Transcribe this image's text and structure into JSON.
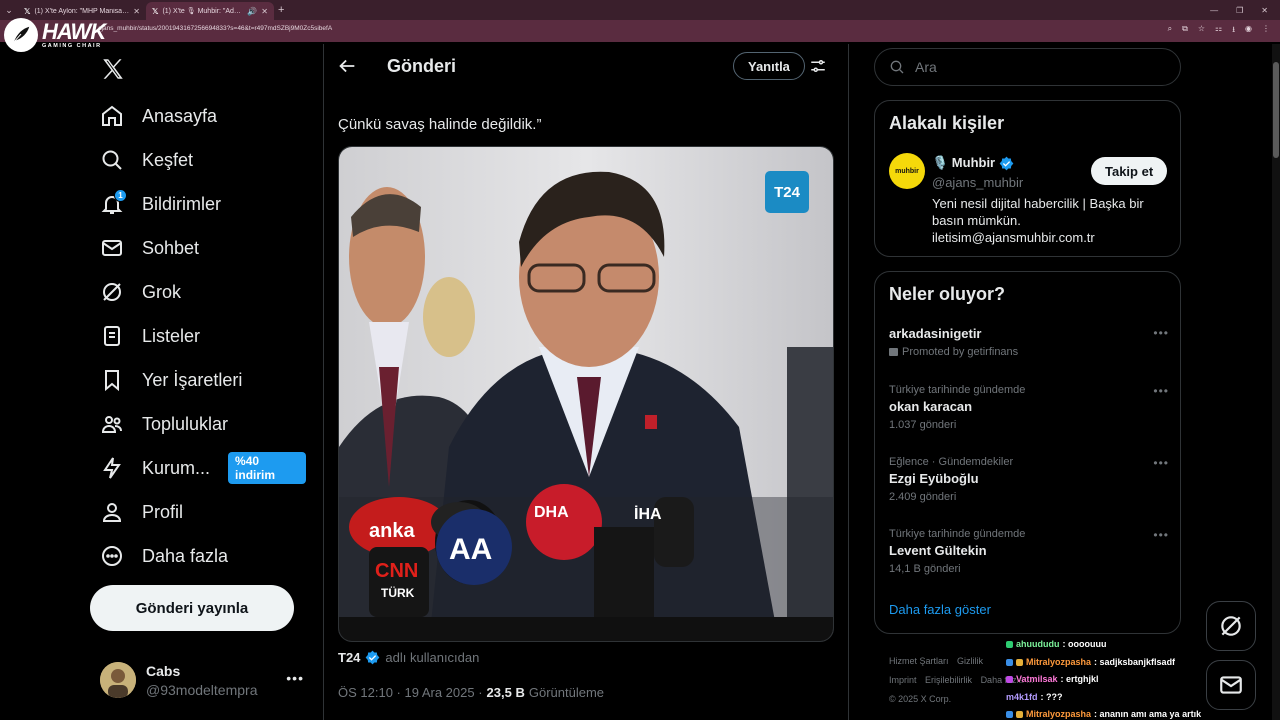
{
  "browser": {
    "tabs": [
      {
        "label": "(1) X'te Aylon: \"MHP Manisa M",
        "active": false
      },
      {
        "label": "(1) X'te 🎙 Muhbir: \"Adalet",
        "active": true
      }
    ],
    "url": "ajans_muhbir/status/2001943167256694833?s=46&t=r497mdSZBj9M0Zc5sibefA"
  },
  "overlay_logo": {
    "big": "HAWK",
    "small": "GAMING CHAIR"
  },
  "nav": {
    "items": [
      {
        "label": "Anasayfa",
        "icon": "home-icon"
      },
      {
        "label": "Keşfet",
        "icon": "search-icon"
      },
      {
        "label": "Bildirimler",
        "icon": "bell-icon",
        "badge": "1"
      },
      {
        "label": "Sohbet",
        "icon": "mail-icon"
      },
      {
        "label": "Grok",
        "icon": "grok-icon"
      },
      {
        "label": "Listeler",
        "icon": "list-icon"
      },
      {
        "label": "Yer İşaretleri",
        "icon": "bookmark-icon"
      },
      {
        "label": "Topluluklar",
        "icon": "people-icon"
      },
      {
        "label": "Kurum...",
        "icon": "bolt-icon",
        "promo": "%40 indirim"
      },
      {
        "label": "Profil",
        "icon": "person-icon"
      },
      {
        "label": "Daha fazla",
        "icon": "more-circle-icon"
      }
    ],
    "post_button": "Gönderi yayınla",
    "account": {
      "name": "Cabs",
      "handle": "@93modeltempra"
    }
  },
  "main": {
    "title": "Gönderi",
    "reply_button": "Yanıtla",
    "tweet_text": "Çünkü savaş halinde değildik.”",
    "media_badge": "T24",
    "source_name": "T24",
    "source_via": "adlı kullanıcıdan",
    "time": "ÖS 12:10 · 19 Ara 2025 ·",
    "views": "23,5 B",
    "views_label": "Görüntüleme"
  },
  "right": {
    "search_placeholder": "Ara",
    "related": {
      "title": "Alakalı kişiler",
      "name": "🎙️ Muhbir",
      "handle": "@ajans_muhbir",
      "avatar_text": "muhbir",
      "follow": "Takip et",
      "bio": "Yeni nesil dijital habercilik | Başka bir basın mümkün. iletisim@ajansmuhbir.com.tr"
    },
    "trending": {
      "title": "Neler oluyor?",
      "items": [
        {
          "category": "",
          "name": "arkadasinigetir",
          "count": "Promoted by getirfinans"
        },
        {
          "category": "Türkiye tarihinde gündemde",
          "name": "okan karacan",
          "count": "1.037 gönderi"
        },
        {
          "category": "Eğlence · Gündemdekiler",
          "name": "Ezgi Eyüboğlu",
          "count": "2.409 gönderi"
        },
        {
          "category": "Türkiye tarihinde gündemde",
          "name": "Levent Gültekin",
          "count": "14,1 B gönderi"
        }
      ],
      "show_more": "Daha fazla göster"
    },
    "footer": [
      "Hizmet Şartları",
      "Gizlilik",
      "Imprint",
      "Erişilebilirlik",
      "Daha fazla ...",
      "© 2025 X Corp."
    ]
  },
  "chat": [
    {
      "user": "ahuududu",
      "msg": ": oooouuu"
    },
    {
      "user": "Mitralyozpasha",
      "msg": ": sadjksbanjkflsadf"
    },
    {
      "user": "Vatmilsak",
      "msg": ": ertghjkl"
    },
    {
      "user": "m4k1fd",
      "msg": ": ???"
    },
    {
      "user": "Mitralyozpasha",
      "msg": ": ananın amı ama ya artık"
    }
  ],
  "colors": {
    "accent": "#1d9bf0",
    "chrome": "#5a2c40",
    "background": "#000000"
  }
}
